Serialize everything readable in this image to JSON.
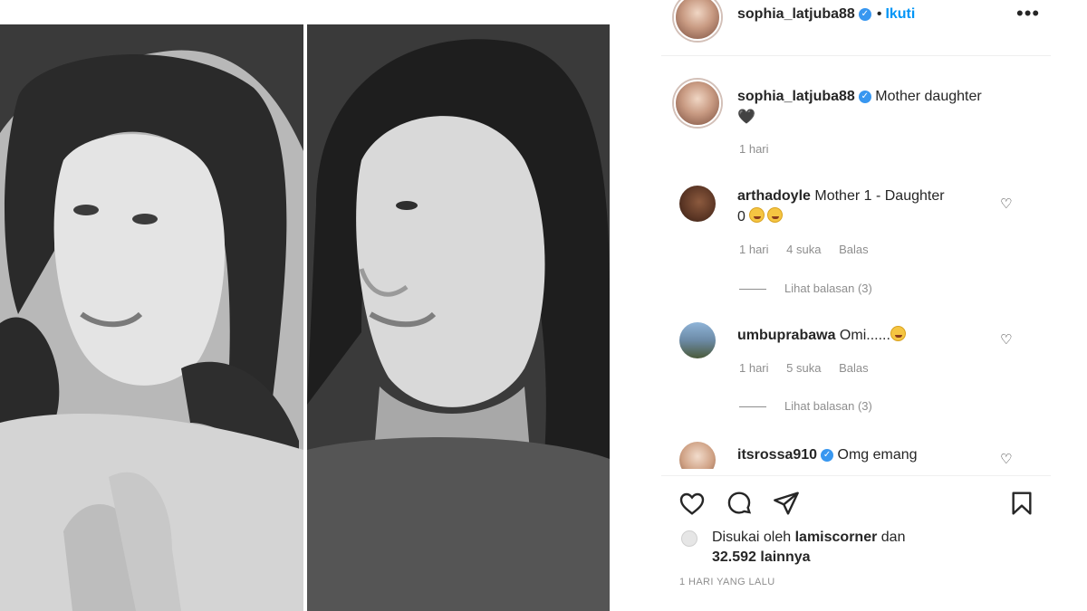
{
  "post": {
    "username": "sophia_latjuba88",
    "follow_label": "Ikuti",
    "more_label": "•••",
    "caption_line1": "Mother daughter",
    "caption_line2": "🖤",
    "caption_time": "1 hari"
  },
  "comments": [
    {
      "username": "arthadoyle",
      "text_line1": "Mother 1 - Daughter",
      "text_line2": "0",
      "time": "1 hari",
      "likes": "4 suka",
      "reply_label": "Balas",
      "view_replies": "Lihat balasan (3)"
    },
    {
      "username": "umbuprabawa",
      "text_line1": "Omi......",
      "time": "1 hari",
      "likes": "5 suka",
      "reply_label": "Balas",
      "view_replies": "Lihat balasan (3)"
    },
    {
      "username": "itsrossa910",
      "text_line1": "Omg emang"
    }
  ],
  "likes": {
    "prefix": "Disukai oleh",
    "liker": "lamiscorner",
    "conj": "dan",
    "count": "32.592 lainnya"
  },
  "post_date": "1 HARI YANG LALU",
  "icons": {
    "like": "heart-icon",
    "comment": "comment-icon",
    "share": "share-icon",
    "save": "bookmark-icon"
  }
}
